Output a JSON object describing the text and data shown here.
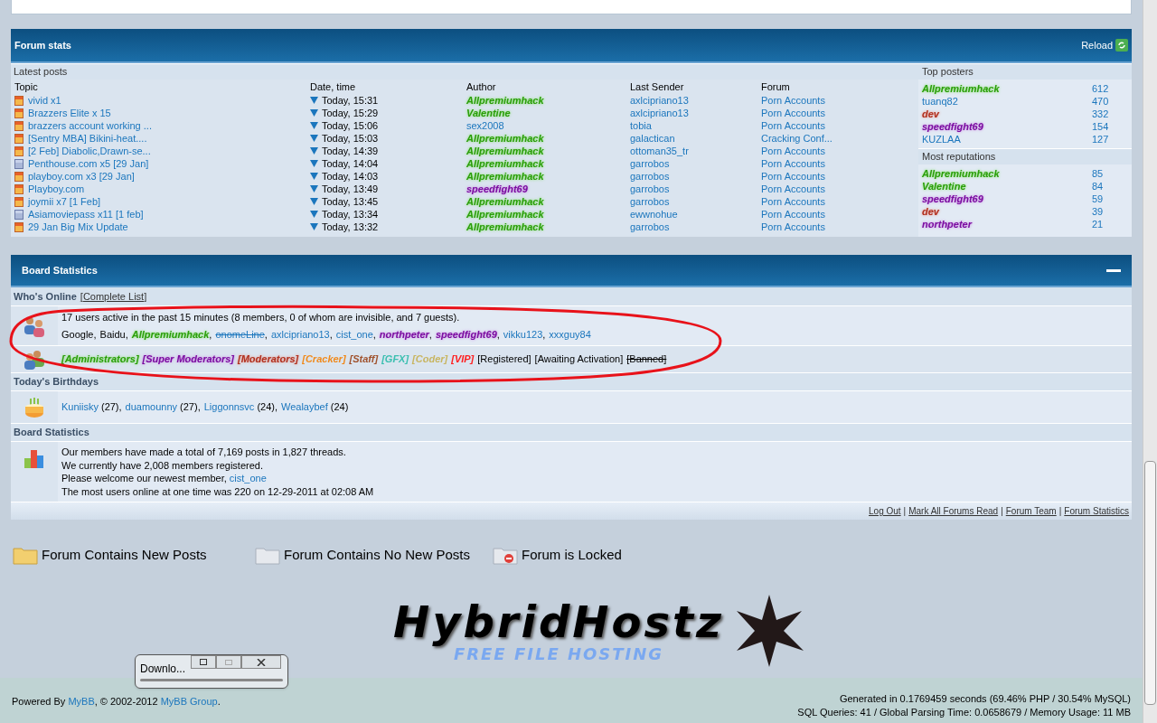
{
  "forum_stats": {
    "title": "Forum stats",
    "reload": "Reload",
    "latest_posts": {
      "heading": "Latest posts",
      "columns": [
        "Topic",
        "Date, time",
        "Author",
        "Last Sender",
        "Forum"
      ],
      "rows": [
        {
          "topic": "vivid x1",
          "new": true,
          "date": "Today, 15:31",
          "author": {
            "name": "Allpremiumhack",
            "kind": "admin"
          },
          "last_sender": "axlcipriano13",
          "forum": "Porn Accounts"
        },
        {
          "topic": "Brazzers Elite x 15",
          "new": true,
          "date": "Today, 15:29",
          "author": {
            "name": "Valentine",
            "kind": "admin"
          },
          "last_sender": "axlcipriano13",
          "forum": "Porn Accounts"
        },
        {
          "topic": "brazzers account working ...",
          "new": true,
          "date": "Today, 15:06",
          "author": {
            "name": "sex2008",
            "kind": "member"
          },
          "last_sender": "tobia",
          "forum": "Porn Accounts"
        },
        {
          "topic": "[Sentry MBA] Bikini-heat....",
          "new": true,
          "date": "Today, 15:03",
          "author": {
            "name": "Allpremiumhack",
            "kind": "admin"
          },
          "last_sender": "galactican",
          "forum": "Cracking Conf..."
        },
        {
          "topic": "[2 Feb] Diabolic,Drawn-se...",
          "new": true,
          "date": "Today, 14:39",
          "author": {
            "name": "Allpremiumhack",
            "kind": "admin"
          },
          "last_sender": "ottoman35_tr",
          "forum": "Porn Accounts"
        },
        {
          "topic": "Penthouse.com x5 [29 Jan]",
          "new": false,
          "date": "Today, 14:04",
          "author": {
            "name": "Allpremiumhack",
            "kind": "admin"
          },
          "last_sender": "garrobos",
          "forum": "Porn Accounts"
        },
        {
          "topic": "playboy.com x3 [29 Jan]",
          "new": true,
          "date": "Today, 14:03",
          "author": {
            "name": "Allpremiumhack",
            "kind": "admin"
          },
          "last_sender": "garrobos",
          "forum": "Porn Accounts"
        },
        {
          "topic": "Playboy.com",
          "new": true,
          "date": "Today, 13:49",
          "author": {
            "name": "speedfight69",
            "kind": "smod"
          },
          "last_sender": "garrobos",
          "forum": "Porn Accounts"
        },
        {
          "topic": "joymii x7 [1 Feb]",
          "new": true,
          "date": "Today, 13:45",
          "author": {
            "name": "Allpremiumhack",
            "kind": "admin"
          },
          "last_sender": "garrobos",
          "forum": "Porn Accounts"
        },
        {
          "topic": "Asiamoviepass x11 [1 feb]",
          "new": false,
          "date": "Today, 13:34",
          "author": {
            "name": "Allpremiumhack",
            "kind": "admin"
          },
          "last_sender": "ewwnohue",
          "forum": "Porn Accounts"
        },
        {
          "topic": "29 Jan Big Mix Update",
          "new": true,
          "date": "Today, 13:32",
          "author": {
            "name": "Allpremiumhack",
            "kind": "admin"
          },
          "last_sender": "garrobos",
          "forum": "Porn Accounts"
        }
      ]
    },
    "top_posters": {
      "heading": "Top posters",
      "rows": [
        {
          "name": "Allpremiumhack",
          "kind": "admin",
          "count": "612"
        },
        {
          "name": "tuanq82",
          "kind": "member",
          "count": "470"
        },
        {
          "name": "dev",
          "kind": "mod",
          "count": "332"
        },
        {
          "name": "speedfight69",
          "kind": "smod",
          "count": "154"
        },
        {
          "name": "KUZLAA",
          "kind": "member",
          "count": "127"
        }
      ]
    },
    "most_reputations": {
      "heading": "Most reputations",
      "rows": [
        {
          "name": "Allpremiumhack",
          "kind": "admin",
          "count": "85"
        },
        {
          "name": "Valentine",
          "kind": "admin",
          "count": "84"
        },
        {
          "name": "speedfight69",
          "kind": "smod",
          "count": "59"
        },
        {
          "name": "dev",
          "kind": "mod",
          "count": "39"
        },
        {
          "name": "northpeter",
          "kind": "smod",
          "count": "21"
        }
      ]
    }
  },
  "board_statistics": {
    "title": "Board Statistics",
    "expanded": true,
    "whos_online": {
      "heading": "Who's Online",
      "complete_list": "[Complete List]",
      "summary": "17 users active in the past 15 minutes (8 members, 0 of whom are invisible, and 7 guests).",
      "users": [
        {
          "name": "Google",
          "kind": "guest",
          "sep": ","
        },
        {
          "name": "Baidu",
          "kind": "guest",
          "sep": ","
        },
        {
          "name": "Allpremiumhack",
          "kind": "admin",
          "sep": ","
        },
        {
          "name": "onomeLine",
          "kind": "banned",
          "sep": ","
        },
        {
          "name": "axlcipriano13",
          "kind": "member",
          "sep": ","
        },
        {
          "name": "cist_one",
          "kind": "member",
          "sep": ","
        },
        {
          "name": "northpeter",
          "kind": "smod",
          "sep": ","
        },
        {
          "name": "speedfight69",
          "kind": "smod",
          "sep": ","
        },
        {
          "name": "vikku123",
          "kind": "member",
          "sep": ","
        },
        {
          "name": "xxxguy84",
          "kind": "member"
        }
      ],
      "legend": [
        {
          "name": "[Administrators]",
          "kind": "admin"
        },
        {
          "name": "[Super Moderators]",
          "kind": "smod"
        },
        {
          "name": "[Moderators]",
          "kind": "mod"
        },
        {
          "name": "[Cracker]",
          "kind": "cracker"
        },
        {
          "name": "[Staff]",
          "kind": "staff"
        },
        {
          "name": "[GFX]",
          "kind": "gfx"
        },
        {
          "name": "[Coder]",
          "kind": "coder"
        },
        {
          "name": "[VIP]",
          "kind": "vip"
        },
        {
          "name": "[Registered]",
          "kind": "guest"
        },
        {
          "name": "[Awaiting Activation]",
          "kind": "guest"
        },
        {
          "name": "[Banned]",
          "kind": "banned_plain"
        }
      ]
    },
    "birthdays": {
      "heading": "Today's Birthdays",
      "people": [
        {
          "name": "Kuniisky",
          "age": "(27),"
        },
        {
          "name": "duamounny",
          "age": "(27),"
        },
        {
          "name": "Liggonnsvc",
          "age": "(24),"
        },
        {
          "name": "Wealaybef",
          "age": "(24)"
        }
      ]
    },
    "stats": {
      "heading": "Board Statistics",
      "posts": "Our members have made a total of 7,169 posts in 1,827 threads.",
      "members": "We currently have 2,008 members registered.",
      "welcome": "Please welcome our newest member,",
      "newest": "cist_one",
      "most_online": "The most users online at one time was 220 on 12-29-2011 at 02:08 AM"
    },
    "links": [
      "Log Out",
      "Mark All Forums Read",
      "Forum Team",
      "Forum Statistics"
    ],
    "link_sep": "|"
  },
  "legend": [
    {
      "kind": "new",
      "label": "Forum Contains New Posts"
    },
    {
      "kind": "none",
      "label": "Forum Contains No New Posts"
    },
    {
      "kind": "locked",
      "label": "Forum is Locked"
    }
  ],
  "logo": {
    "name": "HybridHostz",
    "tagline": "FREE FILE HOSTING"
  },
  "footer": {
    "powered": "Powered By",
    "mybb": "MyBB",
    "copyright": ", © 2002-2012",
    "group": "MyBB Group",
    "end": ".",
    "generated": "Generated in 0.1769459 seconds (69.46% PHP / 30.54% MySQL)",
    "sql": "SQL Queries: 41 / Global Parsing Time: 0.0658679 / Memory Usage: 11 MB"
  },
  "download_window": {
    "title": "Downlo..."
  }
}
